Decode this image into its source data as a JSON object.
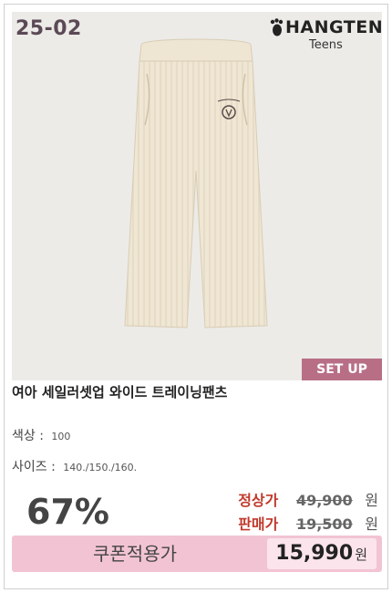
{
  "product": {
    "code": "25-02",
    "brand_name": "HANGTEN",
    "brand_sub": "Teens",
    "badge": "SET UP",
    "title": "여아 세일러셋업 와이드 트레이닝팬츠",
    "color_label": "색상 :",
    "color_value": "100",
    "size_label": "사이즈 :",
    "size_value": "140./150./160."
  },
  "pricing": {
    "discount": "67%",
    "regular_label": "정상가",
    "regular_value": "49,900",
    "sale_label": "판매가",
    "sale_value": "19,500",
    "unit": "원",
    "coupon_label": "쿠폰적용가",
    "coupon_price": "15,990",
    "coupon_unit": "원"
  },
  "colors": {
    "badge": "#b86f86",
    "coupon_bar": "#f2c4d3",
    "price_label": "#c0392b"
  }
}
